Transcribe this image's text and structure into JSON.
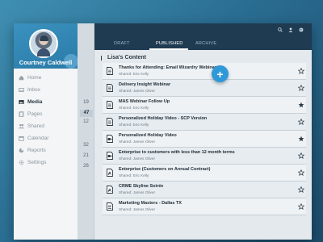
{
  "profile": {
    "name": "Courtney Caldwell"
  },
  "nav": [
    {
      "label": "Home",
      "icon": "home-icon",
      "active": false
    },
    {
      "label": "Inbox",
      "icon": "inbox-icon",
      "active": false
    },
    {
      "label": "Media",
      "icon": "image-icon",
      "active": true
    },
    {
      "label": "Pages",
      "icon": "page-icon",
      "active": false
    },
    {
      "label": "Shared",
      "icon": "people-icon",
      "active": false
    },
    {
      "label": "Calendar",
      "icon": "calendar-icon",
      "active": false
    },
    {
      "label": "Reports",
      "icon": "chart-icon",
      "active": false
    },
    {
      "label": "Settings",
      "icon": "gear-icon",
      "active": false
    }
  ],
  "counts": [
    "19",
    "47",
    "12",
    "32",
    "21",
    "26"
  ],
  "tabs": [
    "DRAFT",
    "PUBLISHED",
    "ARCHIVE"
  ],
  "active_tab": "PUBLISHED",
  "fab_label": "+",
  "section_title": "Lisa's Content",
  "items": [
    {
      "title": "Thanks for Attending: Email Wizardry Webinar",
      "shared": "Shared: Eric Kelly",
      "icon": "document-icon",
      "starred": false
    },
    {
      "title": "Delivery Insight Webinar",
      "shared": "Shared: James Oliver",
      "icon": "document-icon",
      "starred": false
    },
    {
      "title": "MAS Webinar Follow Up",
      "shared": "Shared: Eric Kelly",
      "icon": "document-icon",
      "starred": true
    },
    {
      "title": "Personalized Holiday Video - SCP Version",
      "shared": "Shared: Eric Kelly",
      "icon": "document-icon",
      "starred": false
    },
    {
      "title": "Personalized Holiday Video",
      "shared": "Shared: James Oliver",
      "icon": "video-icon",
      "starred": true
    },
    {
      "title": "Enterprise to customers with less than 12 month terms",
      "shared": "Shared: James Oliver",
      "icon": "video-icon",
      "starred": false
    },
    {
      "title": "Enterprise (Customers on Annual Contract)",
      "shared": "Shared: Eric Kelly",
      "icon": "pdf-icon",
      "starred": false
    },
    {
      "title": "CRME Skyline Soirée",
      "shared": "Shared: James Oliver",
      "icon": "pdf-icon",
      "starred": false
    },
    {
      "title": "Marketing Masters - Dallas TX",
      "shared": "Shared: James Oliver",
      "icon": "document-icon",
      "starred": false
    }
  ],
  "colors": {
    "accent": "#2e98d8",
    "topbar": "#1f3b52",
    "profile": "#2b7aa7"
  }
}
